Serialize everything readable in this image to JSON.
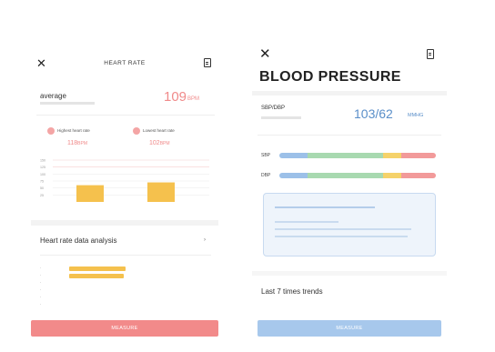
{
  "heart_rate": {
    "title": "HEART RATE",
    "average_label": "average",
    "average_value": "109",
    "average_unit": "BPM",
    "highest_label": "Highest heart rate",
    "highest_value": "118",
    "highest_unit": "BPM",
    "lowest_label": "Lowest heart rate",
    "lowest_value": "102",
    "lowest_unit": "BPM",
    "analysis_title": "Heart rate data analysis",
    "measure_label": "MEASURE",
    "chart_data": {
      "type": "bar",
      "ylim": [
        0,
        150
      ],
      "y_ticks": [
        150,
        125,
        100,
        75,
        50,
        25
      ],
      "values": [
        60,
        70
      ],
      "colors": [
        "#f5c14d",
        "#f5c14d"
      ]
    }
  },
  "blood_pressure": {
    "title": "BLOOD PRESSURE",
    "sbp_dbp_label": "SBP/DBP",
    "value": "103/62",
    "unit": "MMHG",
    "sbp_label": "SBP",
    "dbp_label": "DBP",
    "sbp_level": 0.22,
    "dbp_level": 0.3,
    "gauge_colors": [
      "#9cc0e8",
      "#a8d9b0",
      "#f5d26a",
      "#f29a9a"
    ],
    "trends_label": "Last 7 times trends",
    "measure_label": "MEASURE"
  }
}
